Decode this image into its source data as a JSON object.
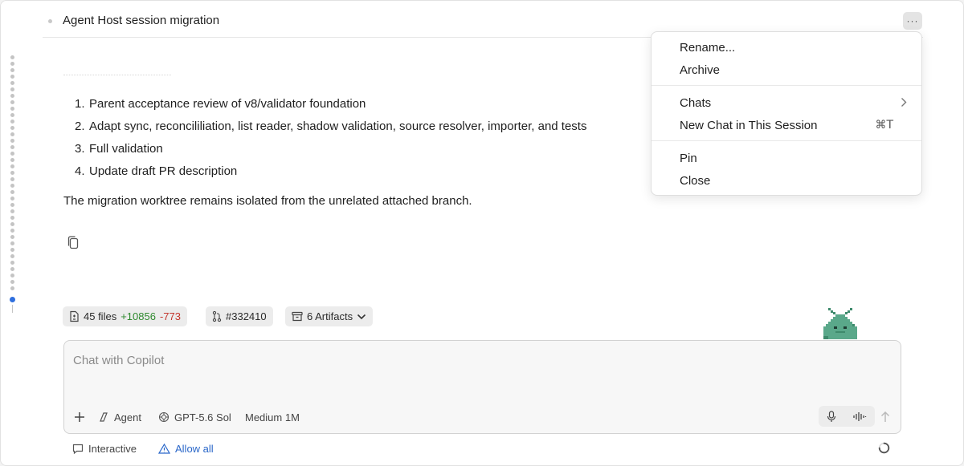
{
  "header": {
    "title": "Agent Host session migration",
    "more_label": "···"
  },
  "content": {
    "steps": [
      {
        "num": "1.",
        "text": "Parent acceptance review of v8/validator foundation"
      },
      {
        "num": "2.",
        "text": "Adapt sync, reconcililiation, list reader, shadow validation, source resolver, importer, and tests"
      },
      {
        "num": "3.",
        "text": "Full validation"
      },
      {
        "num": "4.",
        "text": "Update draft PR description"
      }
    ],
    "paragraph": "The migration worktree remains isolated from the unrelated attached branch."
  },
  "chips": {
    "files_label": "45 files",
    "additions": "+10856",
    "deletions": "-773",
    "pr_label": "#332410",
    "artifacts_label": "6 Artifacts"
  },
  "chat": {
    "placeholder": "Chat with Copilot",
    "mode_label": "Agent",
    "model_label": "GPT-5.6 Sol",
    "effort_label": "Medium 1M"
  },
  "bottom": {
    "interactive_label": "Interactive",
    "allow_label": "Allow all"
  },
  "menu": {
    "items": [
      {
        "label": "Rename..."
      },
      {
        "label": "Archive"
      },
      {
        "label": "Chats"
      },
      {
        "label": "New Chat in This Session",
        "shortcut": "⌘T"
      },
      {
        "label": "Pin"
      },
      {
        "label": "Close"
      }
    ]
  },
  "colors": {
    "accent": "#2f6fde",
    "additions": "#2f8a2f",
    "deletions": "#c4372e",
    "link": "#2a67c9",
    "mascot": "#5aa88a"
  }
}
